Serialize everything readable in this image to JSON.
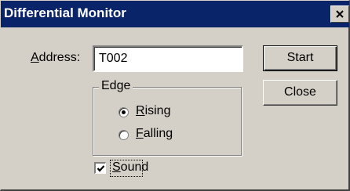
{
  "window": {
    "title": "Differential Monitor"
  },
  "address": {
    "label_prefix": "",
    "label_accel": "A",
    "label_rest": "ddress:",
    "value": "T002"
  },
  "buttons": {
    "start": "Start",
    "close": "Close"
  },
  "edge": {
    "legend": "Edge",
    "rising": {
      "accel": "R",
      "rest": "ising",
      "checked": true
    },
    "falling": {
      "accel": "F",
      "rest": "alling",
      "checked": false
    }
  },
  "sound": {
    "accel": "S",
    "rest": "ound",
    "checked": true
  },
  "icons": {
    "close": "close-icon",
    "check": "checkmark-icon"
  }
}
